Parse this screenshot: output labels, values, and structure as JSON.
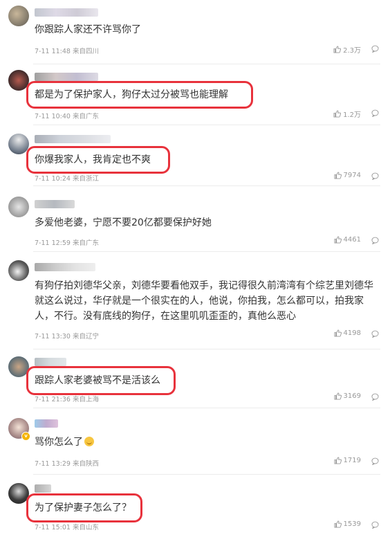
{
  "comments": [
    {
      "text": "你跟踪人家还不许骂你了",
      "meta": "7-11 11:48 来自四川",
      "likes": "2.3万"
    },
    {
      "text": "都是为了保护家人，狗仔太过分被骂也能理解",
      "meta": "7-11 10:40 来自广东",
      "likes": "1.2万"
    },
    {
      "text": "你爆我家人，我肯定也不爽",
      "meta": "7-11 10:24 来自浙江",
      "likes": "7974"
    },
    {
      "text": "多爱他老婆，宁愿不要20亿都要保护好她",
      "meta": "7-11 12:59 来自广东",
      "likes": "4461"
    },
    {
      "text": "有狗仔拍刘德华父亲，刘德华要看他双手，我记得很久前湾湾有个综艺里刘德华就这么说过，华仔就是一个很实在的人，他说，你拍我，怎么都可以，拍我家人，不行。没有底线的狗仔，在这里叽叽歪歪的，真他么恶心",
      "meta": "7-11 13:30 来自辽宁",
      "likes": "4198"
    },
    {
      "text": "跟踪人家老婆被骂不是活该么",
      "meta": "7-11 21:36 来自上海",
      "likes": "3169"
    },
    {
      "text": "骂你怎么了",
      "meta": "7-11 13:29 来自陕西",
      "likes": "1719"
    },
    {
      "text": "为了保护妻子怎么了？",
      "meta": "7-11 15:01 来自山东",
      "likes": "1539"
    }
  ],
  "colors": {
    "highlight": "#e8323c",
    "text": "#333333",
    "meta": "#999999"
  },
  "icons": {
    "like": "thumbs-up-icon",
    "reply": "comment-bubble-icon",
    "emoji": "smile-emoji-icon",
    "badge": "verified-badge-icon"
  }
}
